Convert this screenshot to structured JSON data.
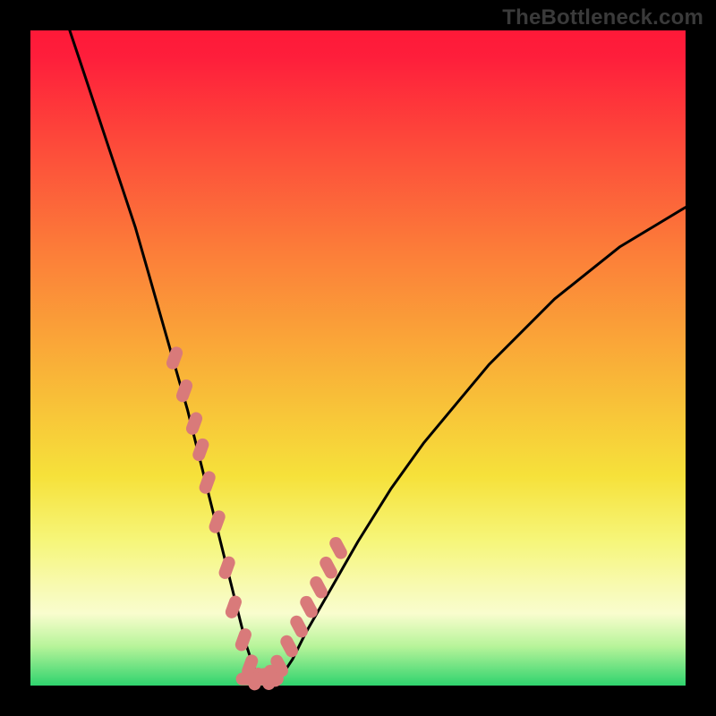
{
  "watermark": "TheBottleneck.com",
  "chart_data": {
    "type": "line",
    "title": "",
    "xlabel": "",
    "ylabel": "",
    "xlim": [
      0,
      100
    ],
    "ylim": [
      0,
      100
    ],
    "grid": false,
    "series": [
      {
        "name": "bottleneck-curve",
        "color": "#000000",
        "x": [
          6,
          8,
          10,
          12,
          14,
          16,
          18,
          20,
          22,
          24,
          26,
          28,
          30,
          32,
          33,
          34,
          35,
          36,
          38,
          40,
          42,
          46,
          50,
          55,
          60,
          65,
          70,
          75,
          80,
          85,
          90,
          95,
          100
        ],
        "y": [
          100,
          94,
          88,
          82,
          76,
          70,
          63,
          56,
          49,
          42,
          34,
          26,
          18,
          10,
          6,
          3,
          1,
          1,
          1,
          4,
          8,
          15,
          22,
          30,
          37,
          43,
          49,
          54,
          59,
          63,
          67,
          70,
          73
        ]
      },
      {
        "name": "highlight-dots-left",
        "color": "#d97a7a",
        "type": "scatter",
        "x": [
          22,
          23.5,
          25,
          26,
          27,
          28.5,
          30,
          31,
          32.5,
          33.5,
          34.5
        ],
        "y": [
          50,
          45,
          40,
          36,
          31,
          25,
          18,
          12,
          7,
          3,
          1
        ]
      },
      {
        "name": "highlight-dots-right",
        "color": "#d97a7a",
        "type": "scatter",
        "x": [
          36,
          37,
          38,
          39.5,
          41,
          42.5,
          44,
          45.5,
          47
        ],
        "y": [
          1,
          1.5,
          3,
          6,
          9,
          12,
          15,
          18,
          21
        ]
      },
      {
        "name": "highlight-floor",
        "color": "#d97a7a",
        "type": "scatter",
        "x": [
          33,
          34,
          35,
          36,
          37
        ],
        "y": [
          1,
          1,
          1,
          1,
          1
        ]
      }
    ]
  }
}
